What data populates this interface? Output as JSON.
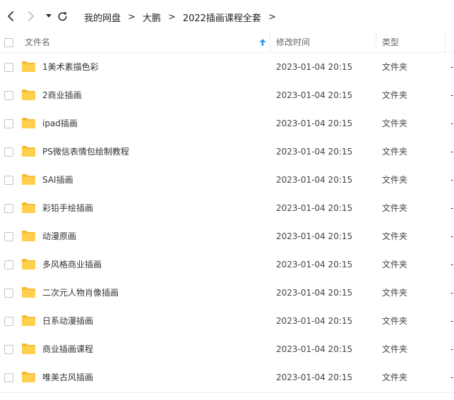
{
  "breadcrumbs": [
    "我的网盘",
    "大鹏",
    "2022插画课程全套"
  ],
  "breadcrumb_separator": ">",
  "columns": {
    "name": "文件名",
    "modified": "修改时间",
    "type": "类型",
    "size": ""
  },
  "colors": {
    "folder": "#FFD04D",
    "folder_tab": "#F5B92F",
    "sort_arrow": "#2E9BF0"
  },
  "files": [
    {
      "name": "1美术素描色彩",
      "modified": "2023-01-04 20:15",
      "type": "文件夹",
      "size": "-"
    },
    {
      "name": "2商业插画",
      "modified": "2023-01-04 20:15",
      "type": "文件夹",
      "size": "-"
    },
    {
      "name": "ipad插画",
      "modified": "2023-01-04 20:15",
      "type": "文件夹",
      "size": "-"
    },
    {
      "name": "PS微信表情包绘制教程",
      "modified": "2023-01-04 20:15",
      "type": "文件夹",
      "size": "-"
    },
    {
      "name": "SAI插画",
      "modified": "2023-01-04 20:15",
      "type": "文件夹",
      "size": "-"
    },
    {
      "name": "彩铅手绘插画",
      "modified": "2023-01-04 20:15",
      "type": "文件夹",
      "size": "-"
    },
    {
      "name": "动漫原画",
      "modified": "2023-01-04 20:15",
      "type": "文件夹",
      "size": "-"
    },
    {
      "name": "多风格商业插画",
      "modified": "2023-01-04 20:15",
      "type": "文件夹",
      "size": "-"
    },
    {
      "name": "二次元人物肖像插画",
      "modified": "2023-01-04 20:15",
      "type": "文件夹",
      "size": "-"
    },
    {
      "name": "日系动漫插画",
      "modified": "2023-01-04 20:15",
      "type": "文件夹",
      "size": "-"
    },
    {
      "name": "商业插画课程",
      "modified": "2023-01-04 20:15",
      "type": "文件夹",
      "size": "-"
    },
    {
      "name": "唯美古风插画",
      "modified": "2023-01-04 20:15",
      "type": "文件夹",
      "size": "-"
    }
  ]
}
